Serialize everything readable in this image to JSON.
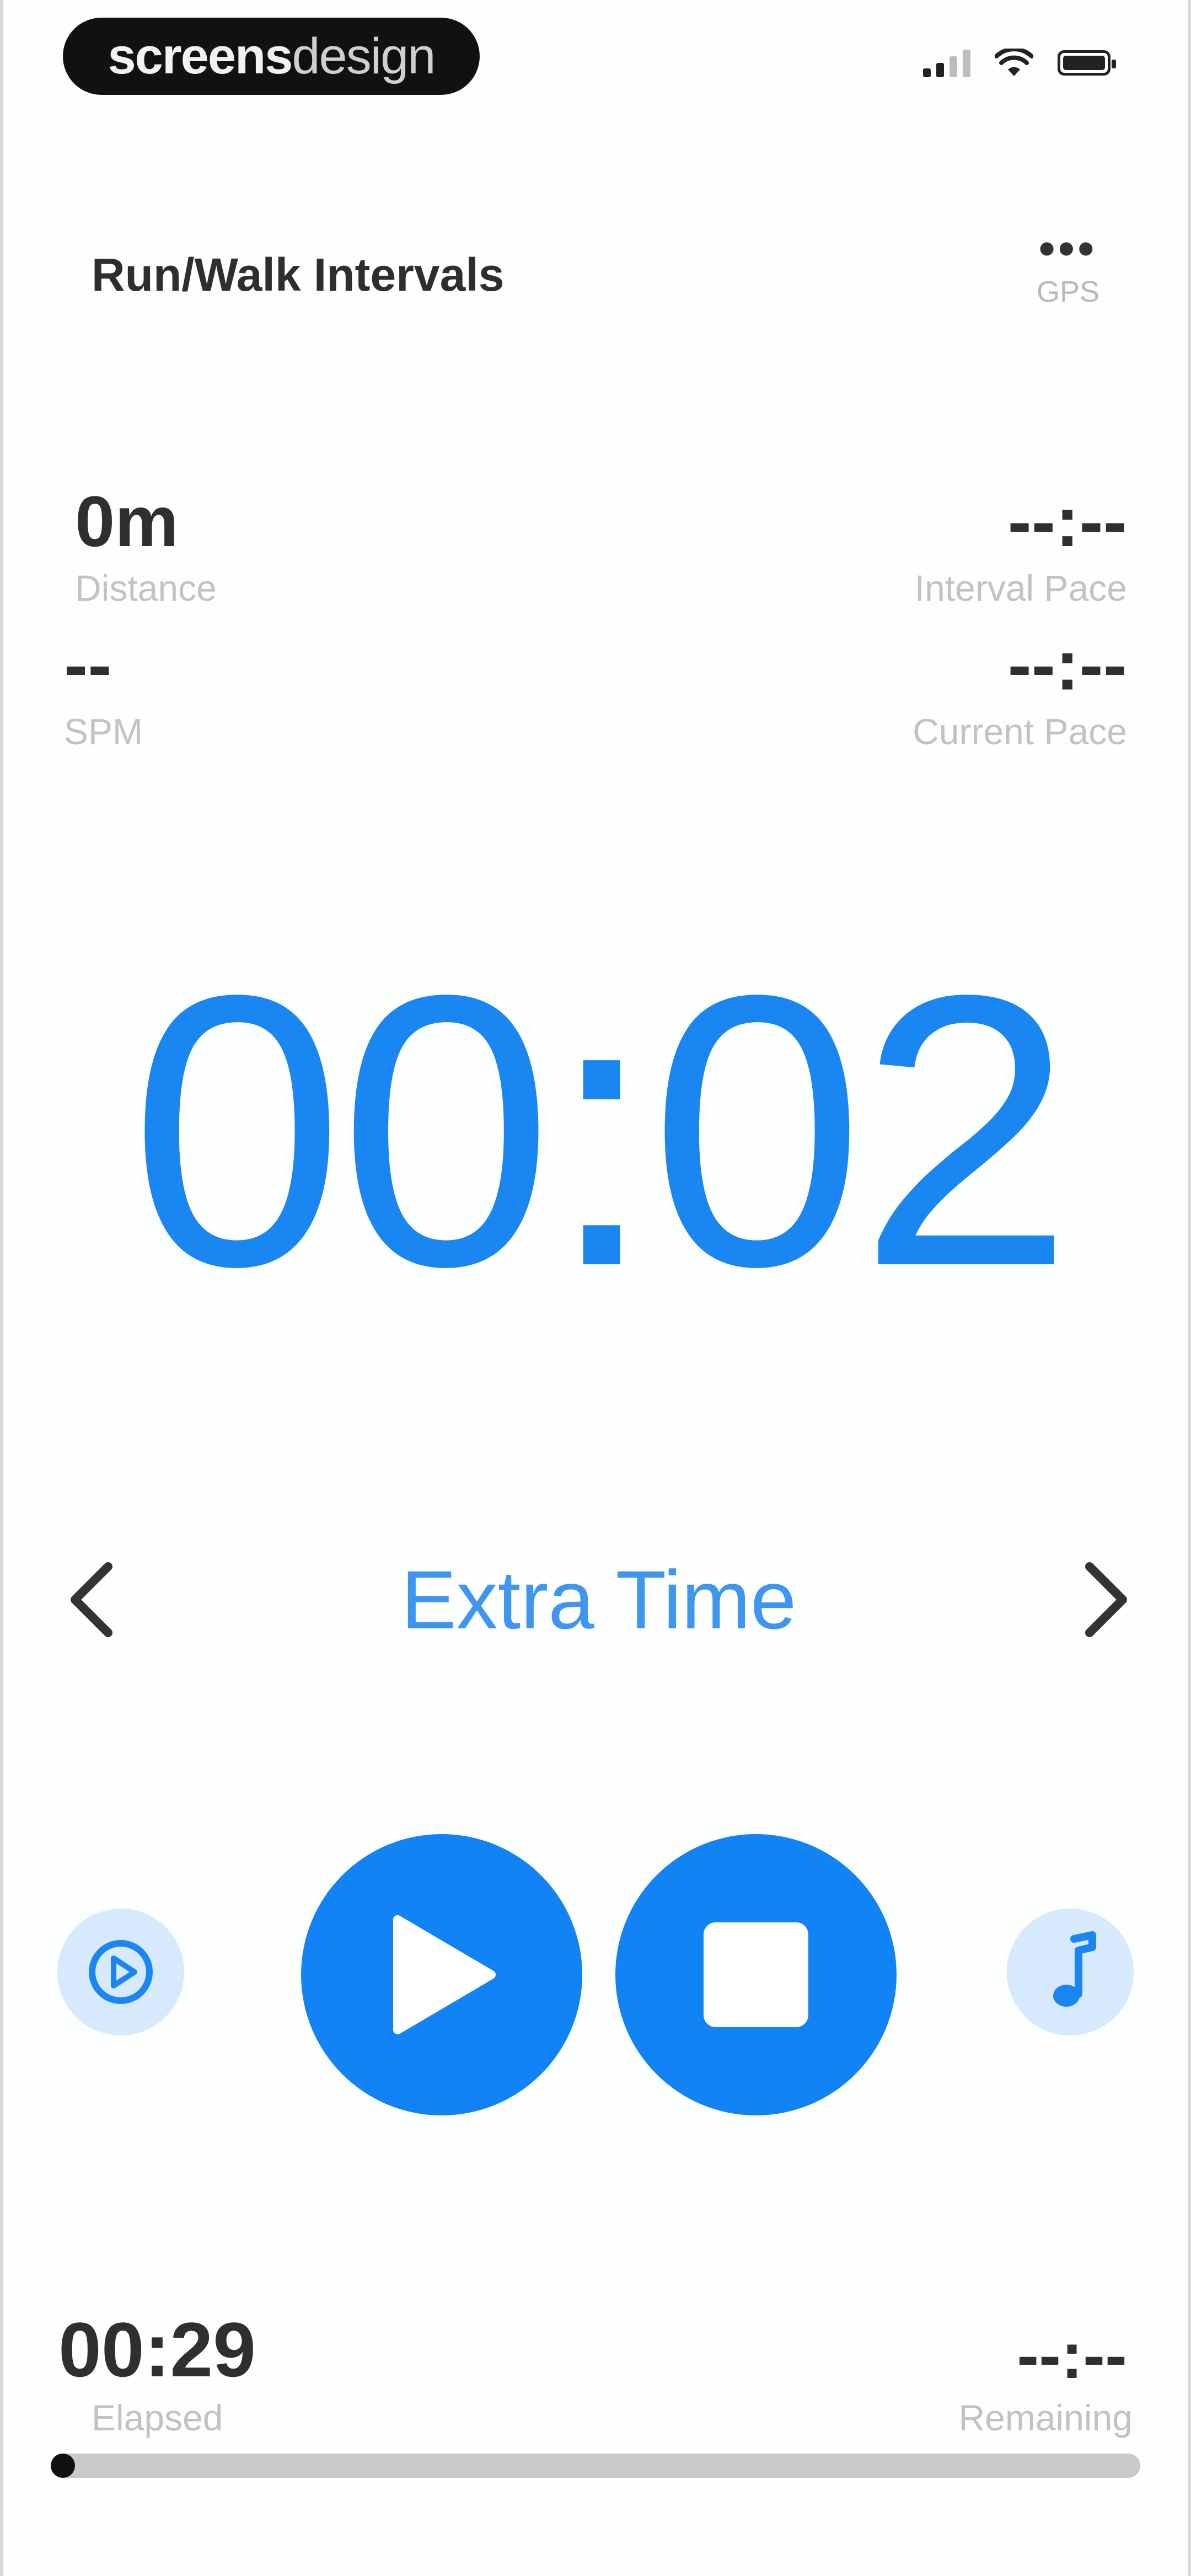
{
  "status_bar": {
    "brand_bold": "screens",
    "brand_thin": "design"
  },
  "header": {
    "title": "Run/Walk Intervals",
    "gps_value": "•••",
    "gps_label": "GPS"
  },
  "metrics": {
    "distance": {
      "value": "0m",
      "label": "Distance"
    },
    "interval_pace": {
      "value": "--:--",
      "label": "Interval Pace"
    },
    "spm": {
      "value": "--",
      "label": "SPM"
    },
    "current_pace": {
      "value": "--:--",
      "label": "Current Pace"
    }
  },
  "timer": {
    "display": "00:02"
  },
  "interval": {
    "label": "Extra Time"
  },
  "controls": {
    "left_icon": "play-circle-icon",
    "right_icon": "music-note-icon",
    "play_icon": "play-icon",
    "stop_icon": "stop-icon"
  },
  "bottom": {
    "elapsed_value": "00:29",
    "elapsed_label": "Elapsed",
    "remaining_value": "--:--",
    "remaining_label": "Remaining"
  },
  "progress": {
    "fraction": 0.0
  },
  "colors": {
    "accent": "#1283f4",
    "accent_light": "#d6e9fd",
    "label_gray": "#c2c2c2"
  }
}
